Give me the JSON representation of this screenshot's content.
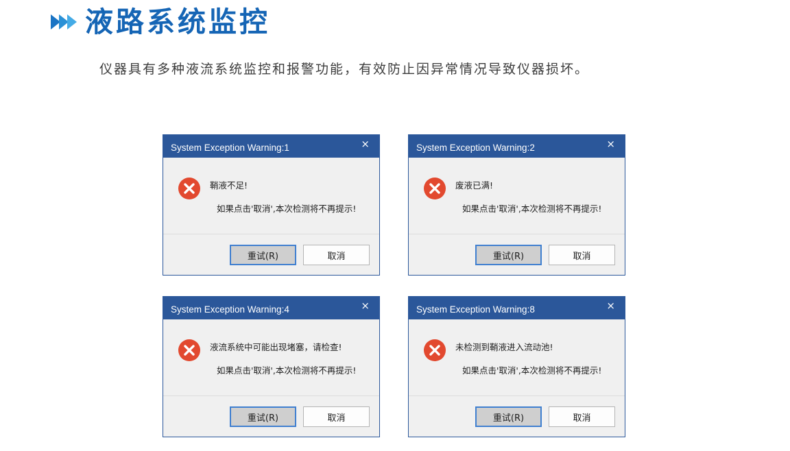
{
  "heading": {
    "title": "液路系统监控",
    "accent_color": "#1565b5",
    "icon": "triple-chevron-right-icon"
  },
  "description": "仪器具有多种液流系统监控和报警功能，有效防止因异常情况导致仪器损坏。",
  "dialog_theme": {
    "titlebar_color": "#2b579a",
    "error_icon": "error-circle-x-icon",
    "error_icon_color": "#e2492f",
    "close_icon": "close-icon"
  },
  "dialogs": [
    {
      "title": "System Exception Warning:1",
      "close": "×",
      "message": "鞘液不足!",
      "note": "如果点击'取消',本次检测将不再提示!",
      "retry_label": "重试(R)",
      "cancel_label": "取消"
    },
    {
      "title": "System Exception Warning:2",
      "close": "×",
      "message": "废液已满!",
      "note": "如果点击'取消',本次检测将不再提示!",
      "retry_label": "重试(R)",
      "cancel_label": "取消"
    },
    {
      "title": "System Exception Warning:4",
      "close": "×",
      "message": "液流系统中可能出现堵塞，请检查!",
      "note": "如果点击'取消',本次检测将不再提示!",
      "retry_label": "重试(R)",
      "cancel_label": "取消"
    },
    {
      "title": "System Exception Warning:8",
      "close": "×",
      "message": "未检测到鞘液进入流动池!",
      "note": "如果点击'取消',本次检测将不再提示!",
      "retry_label": "重试(R)",
      "cancel_label": "取消"
    }
  ]
}
